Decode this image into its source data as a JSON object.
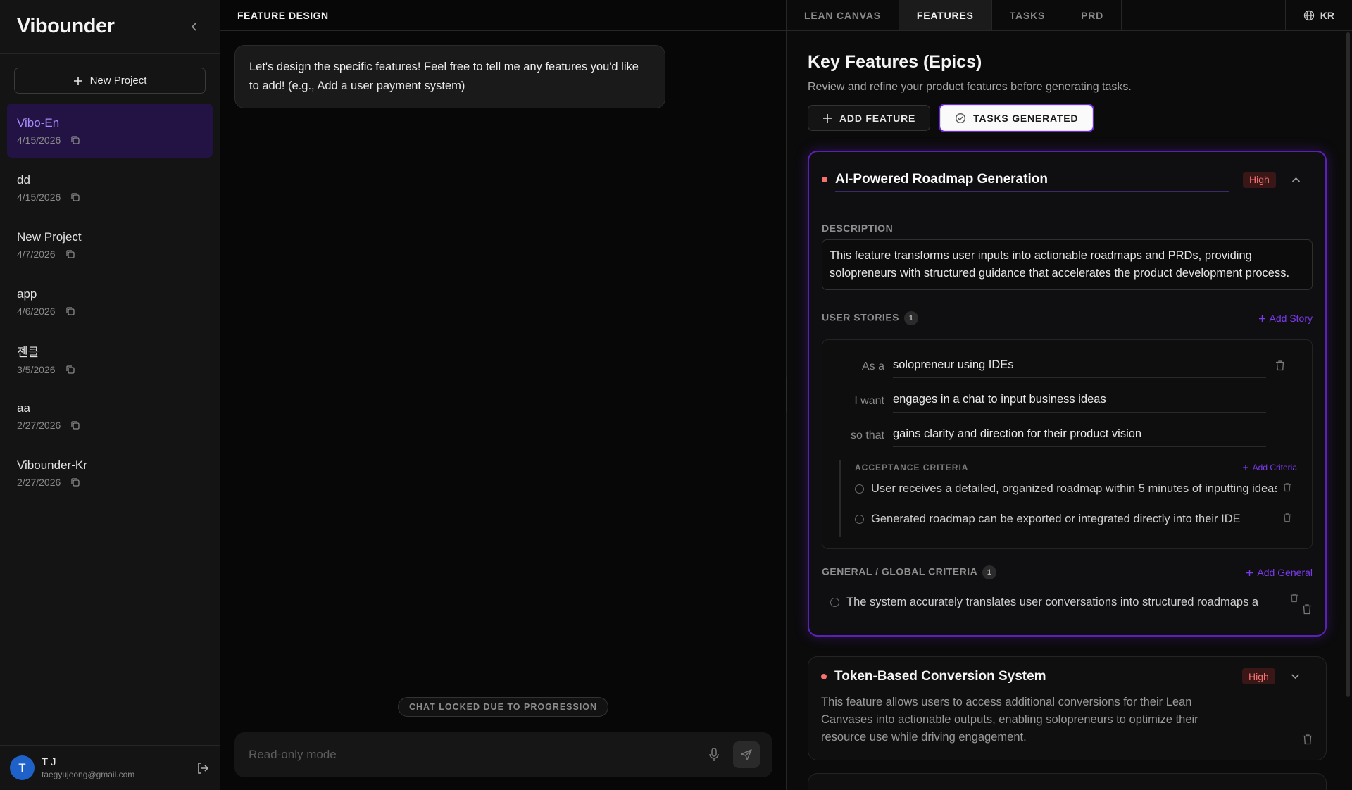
{
  "sidebar": {
    "title": "Vibounder",
    "new_project_label": "New Project",
    "projects": [
      {
        "name": "Vibo-En",
        "date": "4/15/2026"
      },
      {
        "name": "dd",
        "date": "4/15/2026"
      },
      {
        "name": "New Project",
        "date": "4/7/2026"
      },
      {
        "name": "app",
        "date": "4/6/2026"
      },
      {
        "name": "젠클",
        "date": "3/5/2026"
      },
      {
        "name": "aa",
        "date": "2/27/2026"
      },
      {
        "name": "Vibounder-Kr",
        "date": "2/27/2026"
      }
    ],
    "user": {
      "initial": "T",
      "name": "T J",
      "email": "taegyujeong@gmail.com"
    }
  },
  "chat": {
    "header": "FEATURE DESIGN",
    "message": "Let's design the specific features! Feel free to tell me any features you'd like to add! (e.g., Add a user payment system)",
    "lock_badge": "CHAT LOCKED DUE TO PROGRESSION",
    "input_placeholder": "Read-only mode"
  },
  "panel": {
    "tabs": [
      "LEAN CANVAS",
      "FEATURES",
      "TASKS",
      "PRD"
    ],
    "active_tab": "FEATURES",
    "lang": "KR",
    "title": "Key Features (Epics)",
    "subtitle": "Review and refine your product features before generating tasks.",
    "add_feature_label": "ADD FEATURE",
    "tasks_generated_label": "TASKS GENERATED",
    "feature1": {
      "title": "AI-Powered Roadmap Generation",
      "priority": "High",
      "description_label": "DESCRIPTION",
      "description": "This feature transforms user inputs into actionable roadmaps and PRDs, providing solopreneurs with structured guidance that accelerates the product development process.",
      "user_stories_label": "USER STORIES",
      "user_stories_count": "1",
      "add_story_label": "Add Story",
      "story": {
        "as_a_label": "As a",
        "as_a": "solopreneur using IDEs",
        "i_want_label": "I want",
        "i_want": "engages in a chat to input business ideas",
        "so_that_label": "so that",
        "so_that": "gains clarity and direction for their product vision"
      },
      "acceptance_label": "ACCEPTANCE CRITERIA",
      "add_criteria_label": "Add Criteria",
      "acceptance": [
        "User receives a detailed, organized roadmap within 5 minutes of inputting ideas",
        "Generated roadmap can be exported or integrated directly into their IDE"
      ],
      "general_label": "GENERAL / GLOBAL CRITERIA",
      "general_count": "1",
      "add_general_label": "Add General",
      "general": [
        "The system accurately translates user conversations into structured roadmaps a"
      ]
    },
    "feature2": {
      "title": "Token-Based Conversion System",
      "priority": "High",
      "description": "This feature allows users to access additional conversions for their Lean Canvases into actionable outputs, enabling solopreneurs to optimize their resource use while driving engagement."
    }
  },
  "colors": {
    "accent": "#7c3aed",
    "priority": "#f87171",
    "active_bg": "#221344"
  }
}
